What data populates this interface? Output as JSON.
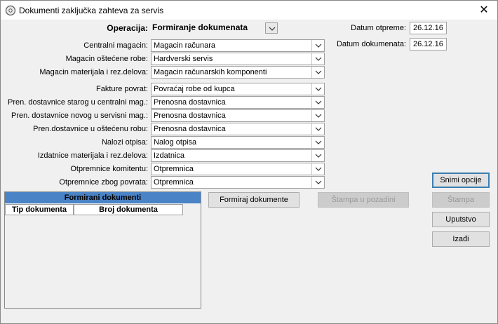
{
  "window": {
    "title": "Dokumenti zaključka zahteva za servis",
    "close_glyph": "✕"
  },
  "operacija": {
    "label": "Operacija:",
    "value": "Formiranje dokumenata"
  },
  "datum_otpreme": {
    "label": "Datum otpreme:",
    "value": "26.12.16"
  },
  "datum_dokumenata": {
    "label": "Datum dokumenata:",
    "value": "26.12.16"
  },
  "fields": [
    {
      "label": "Centralni magacin:",
      "value": "Magacin računara"
    },
    {
      "label": "Magacin oštećene robe:",
      "value": "Hardverski servis"
    },
    {
      "label": "Magacin materijala i rez.delova:",
      "value": "Magacin računarskih komponenti"
    },
    {
      "label": "Fakture povrat:",
      "value": "Povraćaj robe od kupca"
    },
    {
      "label": "Pren. dostavnice starog u centralni mag.:",
      "value": "Prenosna dostavnica"
    },
    {
      "label": "Pren. dostavnice novog u servisni mag.:",
      "value": "Prenosna dostavnica"
    },
    {
      "label": "Pren.dostavnice u oštećenu robu:",
      "value": "Prenosna dostavnica"
    },
    {
      "label": "Nalozi otpisa:",
      "value": "Nalog otpisa"
    },
    {
      "label": "Izdatnice materijala i rez.delova:",
      "value": "Izdatnica"
    },
    {
      "label": "Otpremnice komitentu:",
      "value": "Otpremnica"
    },
    {
      "label": "Otpremnice zbog povrata:",
      "value": "Otpremnica"
    }
  ],
  "buttons": {
    "snimi_opcije": "Snimi opcije",
    "formiraj": "Formiraj dokumente",
    "stampa_pozadini": "Štampa u pozadini",
    "stampa": "Štampa",
    "uputstvo": "Uputstvo",
    "izadji": "Izađi"
  },
  "grid": {
    "title": "Formirani dokumenti",
    "columns": [
      "Tip dokumenta",
      "Broj dokumenta"
    ]
  },
  "icons": {
    "window": "disc-gear-icon",
    "dropdown": "chevron-down-icon"
  }
}
